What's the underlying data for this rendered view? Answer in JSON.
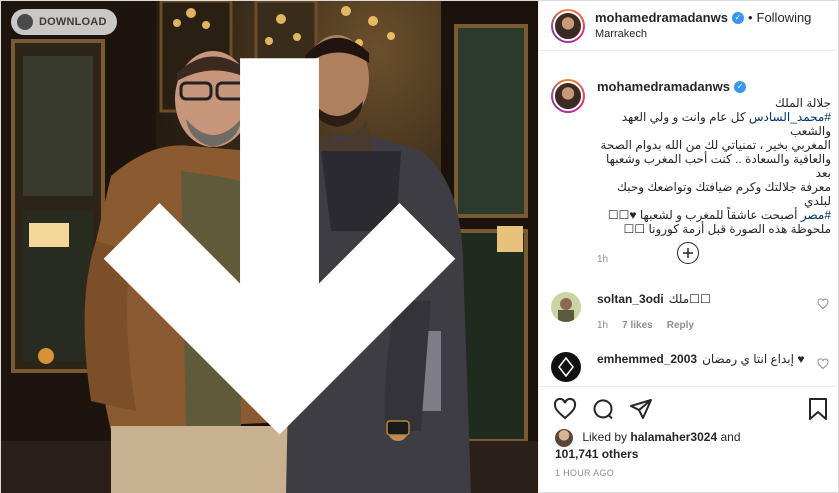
{
  "photo": {
    "download_label": "DOWNLOAD",
    "download_icon": "download-icon"
  },
  "post_header": {
    "username": "mohamedramadanws",
    "verified_icon": "verified-badge-icon",
    "separator": "•",
    "follow_status": "Following",
    "location": "Marrakech"
  },
  "caption": {
    "username": "mohamedramadanws",
    "lines": [
      {
        "pre": "جلالة الملك ",
        "tag": "",
        "post": ""
      },
      {
        "pre": "",
        "tag": "#محمد_السادس",
        "post": " كل عام وانت و ولي العهد والشعب"
      },
      {
        "pre": "المغربي بخير ، تمنياتي لك من الله بدوام الصحة",
        "tag": "",
        "post": ""
      },
      {
        "pre": "والعافية والسعادة .. كنت أحب المغرب وشعبها بعد",
        "tag": "",
        "post": ""
      },
      {
        "pre": "معرفة جلالتك وكرم ضيافتك وتواضعك وحبك لبلدي",
        "tag": "",
        "post": ""
      },
      {
        "pre": "",
        "tag": "#مصر",
        "post": " أصبحت عاشقاً للمغرب و لشعبها ♥☐☐"
      },
      {
        "pre": "ملحوظة هذه الصورة قبل أزمة كورونا ☐☐",
        "tag": "",
        "post": ""
      }
    ],
    "time": "1h"
  },
  "load_more_icon": "plus-circle-icon",
  "comments": [
    {
      "username": "soltan_3odi",
      "text": "ملك☐☐",
      "time": "1h",
      "likes": "7 likes",
      "reply": "Reply"
    },
    {
      "username": "emhemmed_2003",
      "text": "إبداع انتا ي رمضان ♥",
      "time": "",
      "likes": "",
      "reply": ""
    }
  ],
  "actions": {
    "like_icon": "heart-icon",
    "comment_icon": "comment-icon",
    "share_icon": "share-icon",
    "save_icon": "bookmark-icon"
  },
  "likes": {
    "prefix": "Liked by",
    "user": "halamaher3024",
    "conj": "and",
    "count": "101,741 others"
  },
  "posted": "1 HOUR AGO"
}
